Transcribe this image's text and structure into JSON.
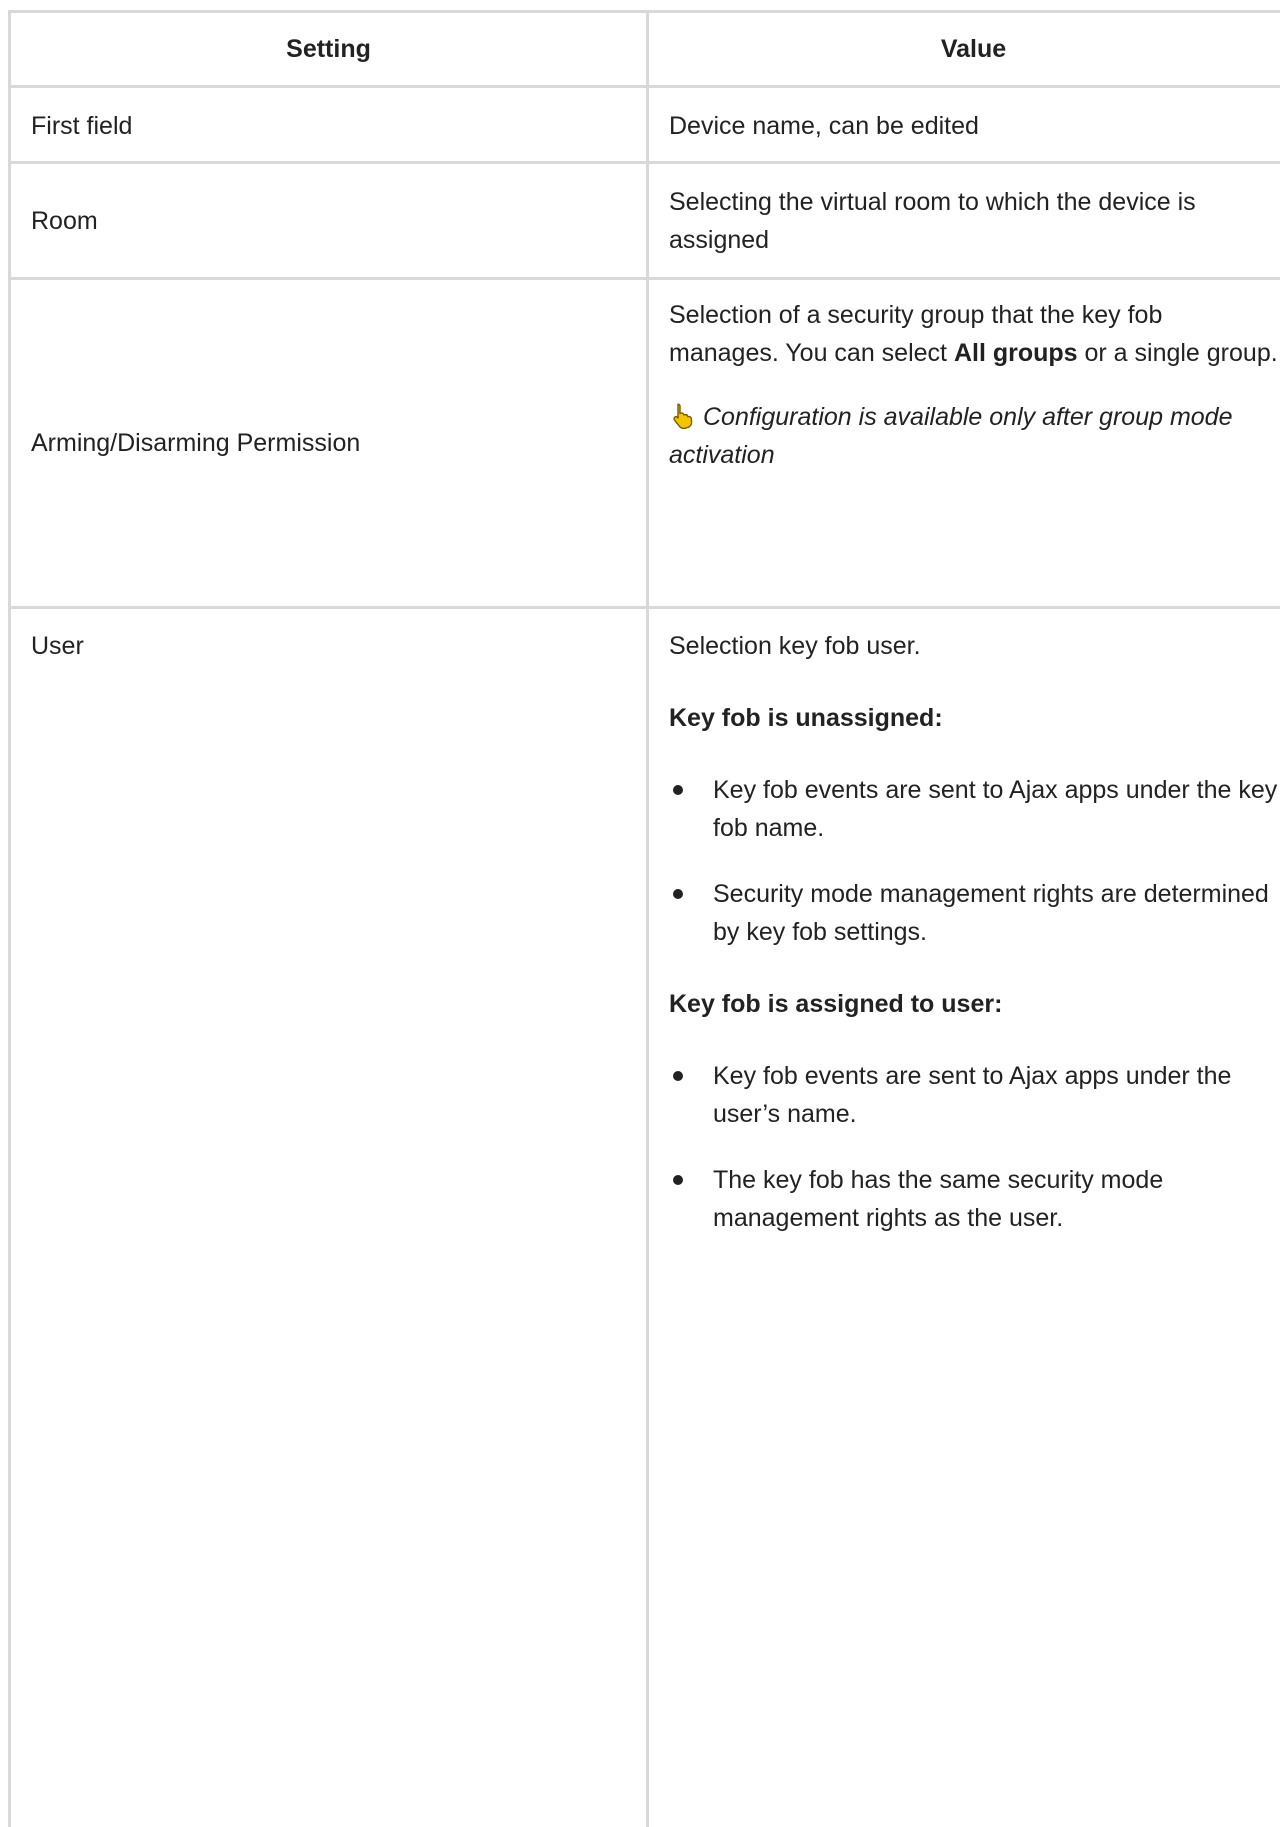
{
  "table": {
    "headers": {
      "setting": "Setting",
      "value": "Value"
    },
    "rows": {
      "first_field": {
        "setting": "First field",
        "value": "Device name, can be edited"
      },
      "room": {
        "setting": "Room",
        "value": "Selecting the virtual room to which the device is assigned"
      },
      "permission": {
        "setting": "Arming/Disarming Permission",
        "value_before": "Selection of a security group that the key fob manages. You can select ",
        "value_bold": "All groups",
        "value_after": " or a single group.",
        "note_icon": "pointing-hand-icon",
        "note": "Configuration is available only after group mode activation"
      },
      "user": {
        "setting": "User",
        "intro": "Selection key fob user.",
        "unassigned_heading": "Key fob is unassigned:",
        "unassigned_items": [
          "Key fob events are sent to Ajax apps under the key fob name.",
          "Security mode management rights are determined by key fob settings."
        ],
        "assigned_heading": "Key fob is assigned to user:",
        "assigned_items": [
          "Key fob events are sent to Ajax apps under the user’s name.",
          "The key fob has the same security mode management rights as the user."
        ]
      }
    }
  },
  "colors": {
    "border": "#d9d9d9",
    "text": "#222222",
    "icon_fill": "#f5c400",
    "icon_stroke": "#7a5a00"
  }
}
